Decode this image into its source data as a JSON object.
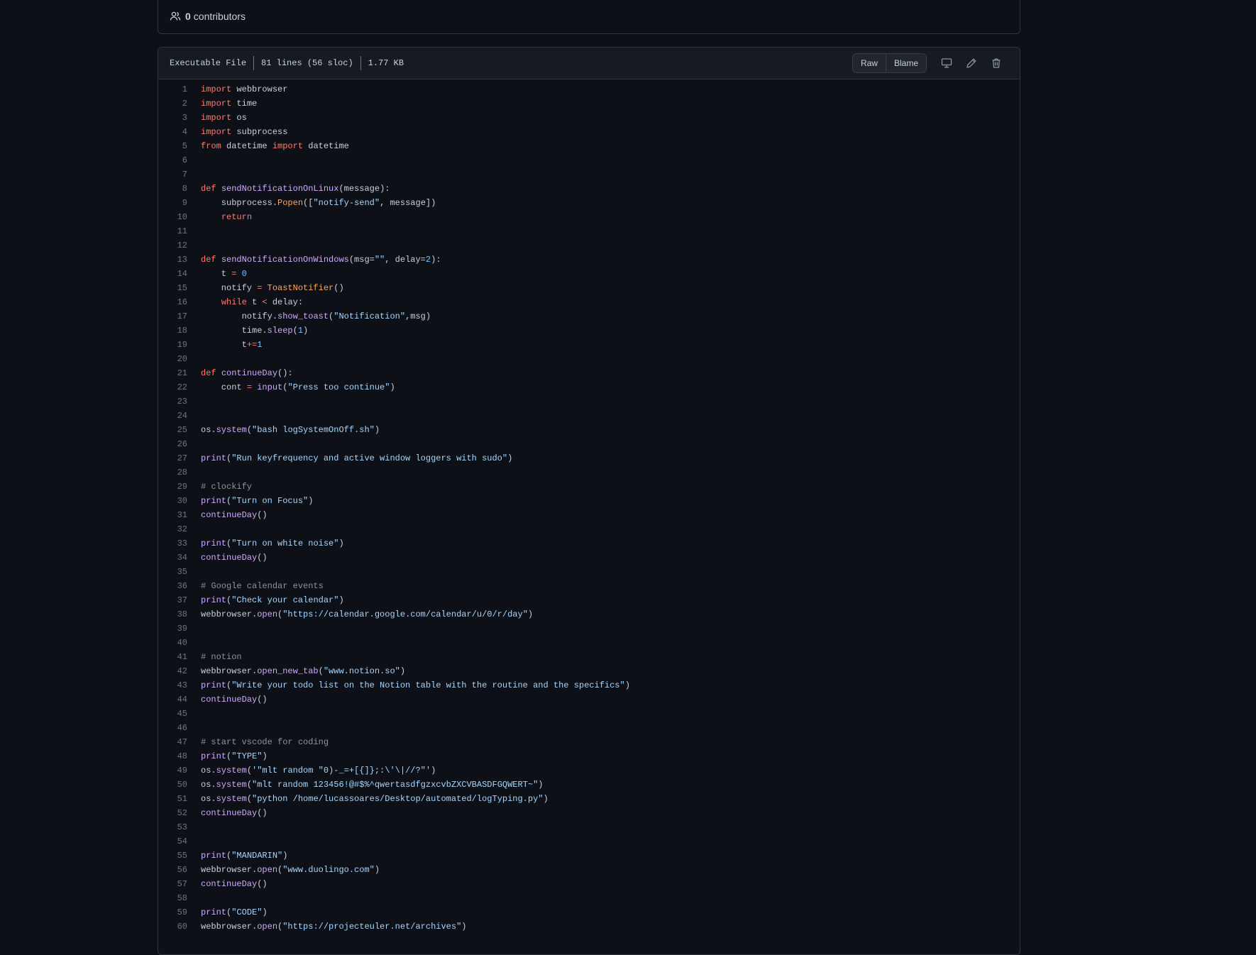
{
  "contributors": {
    "count": "0",
    "label": "contributors"
  },
  "file_header": {
    "type": "Executable File",
    "lines": "81 lines (56 sloc)",
    "size": "1.77 KB",
    "raw_label": "Raw",
    "blame_label": "Blame",
    "icons": [
      "desktop-icon",
      "pencil-icon",
      "trash-icon"
    ]
  },
  "colors": {
    "background": "#0d1117",
    "keyword": "#ff7b72",
    "function": "#d2a8ff",
    "string": "#a5d6ff",
    "class": "#ffa657",
    "number": "#79c0ff",
    "comment": "#8b949e"
  },
  "code_lines": [
    [
      [
        "kw",
        "import"
      ],
      [
        "t",
        " webbrowser"
      ]
    ],
    [
      [
        "kw",
        "import"
      ],
      [
        "t",
        " time"
      ]
    ],
    [
      [
        "kw",
        "import"
      ],
      [
        "t",
        " os"
      ]
    ],
    [
      [
        "kw",
        "import"
      ],
      [
        "t",
        " subprocess"
      ]
    ],
    [
      [
        "kw",
        "from"
      ],
      [
        "t",
        " datetime "
      ],
      [
        "kw",
        "import"
      ],
      [
        "t",
        " datetime"
      ]
    ],
    [],
    [],
    [
      [
        "kw",
        "def"
      ],
      [
        "t",
        " "
      ],
      [
        "fn",
        "sendNotificationOnLinux"
      ],
      [
        "t",
        "(message):"
      ]
    ],
    [
      [
        "t",
        "    subprocess."
      ],
      [
        "cls",
        "Popen"
      ],
      [
        "t",
        "(["
      ],
      [
        "str",
        "\"notify-send\""
      ],
      [
        "t",
        ", message])"
      ]
    ],
    [
      [
        "t",
        "    "
      ],
      [
        "kw",
        "return"
      ]
    ],
    [],
    [],
    [
      [
        "kw",
        "def"
      ],
      [
        "t",
        " "
      ],
      [
        "fn",
        "sendNotificationOnWindows"
      ],
      [
        "t",
        "(msg="
      ],
      [
        "str",
        "\"\""
      ],
      [
        "t",
        ", delay="
      ],
      [
        "num",
        "2"
      ],
      [
        "t",
        "):"
      ]
    ],
    [
      [
        "t",
        "    t "
      ],
      [
        "op",
        "="
      ],
      [
        "t",
        " "
      ],
      [
        "num",
        "0"
      ]
    ],
    [
      [
        "t",
        "    notify "
      ],
      [
        "op",
        "="
      ],
      [
        "t",
        " "
      ],
      [
        "cls",
        "ToastNotifier"
      ],
      [
        "t",
        "()"
      ]
    ],
    [
      [
        "t",
        "    "
      ],
      [
        "kw",
        "while"
      ],
      [
        "t",
        " t "
      ],
      [
        "op",
        "<"
      ],
      [
        "t",
        " delay:"
      ]
    ],
    [
      [
        "t",
        "        notify."
      ],
      [
        "fn",
        "show_toast"
      ],
      [
        "t",
        "("
      ],
      [
        "str",
        "\"Notification\""
      ],
      [
        "t",
        ",msg)"
      ]
    ],
    [
      [
        "t",
        "        time."
      ],
      [
        "fn",
        "sleep"
      ],
      [
        "t",
        "("
      ],
      [
        "num",
        "1"
      ],
      [
        "t",
        ")"
      ]
    ],
    [
      [
        "t",
        "        t"
      ],
      [
        "op",
        "+="
      ],
      [
        "num",
        "1"
      ]
    ],
    [],
    [
      [
        "kw",
        "def"
      ],
      [
        "t",
        " "
      ],
      [
        "fn",
        "continueDay"
      ],
      [
        "t",
        "():"
      ]
    ],
    [
      [
        "t",
        "    cont "
      ],
      [
        "op",
        "="
      ],
      [
        "t",
        " "
      ],
      [
        "fn",
        "input"
      ],
      [
        "t",
        "("
      ],
      [
        "str",
        "\"Press too continue\""
      ],
      [
        "t",
        ")"
      ]
    ],
    [],
    [],
    [
      [
        "t",
        "os."
      ],
      [
        "fn",
        "system"
      ],
      [
        "t",
        "("
      ],
      [
        "str",
        "\"bash logSystemOnOff.sh\""
      ],
      [
        "t",
        ")"
      ]
    ],
    [],
    [
      [
        "fn",
        "print"
      ],
      [
        "t",
        "("
      ],
      [
        "str",
        "\"Run keyfrequency and active window loggers with sudo\""
      ],
      [
        "t",
        ")"
      ]
    ],
    [],
    [
      [
        "cm",
        "# clockify"
      ]
    ],
    [
      [
        "fn",
        "print"
      ],
      [
        "t",
        "("
      ],
      [
        "str",
        "\"Turn on Focus\""
      ],
      [
        "t",
        ")"
      ]
    ],
    [
      [
        "fn",
        "continueDay"
      ],
      [
        "t",
        "()"
      ]
    ],
    [],
    [
      [
        "fn",
        "print"
      ],
      [
        "t",
        "("
      ],
      [
        "str",
        "\"Turn on white noise\""
      ],
      [
        "t",
        ")"
      ]
    ],
    [
      [
        "fn",
        "continueDay"
      ],
      [
        "t",
        "()"
      ]
    ],
    [],
    [
      [
        "cm",
        "# Google calendar events"
      ]
    ],
    [
      [
        "fn",
        "print"
      ],
      [
        "t",
        "("
      ],
      [
        "str",
        "\"Check your calendar\""
      ],
      [
        "t",
        ")"
      ]
    ],
    [
      [
        "t",
        "webbrowser."
      ],
      [
        "fn",
        "open"
      ],
      [
        "t",
        "("
      ],
      [
        "str",
        "\"https://calendar.google.com/calendar/u/0/r/day\""
      ],
      [
        "t",
        ")"
      ]
    ],
    [],
    [],
    [
      [
        "cm",
        "# notion"
      ]
    ],
    [
      [
        "t",
        "webbrowser."
      ],
      [
        "fn",
        "open_new_tab"
      ],
      [
        "t",
        "("
      ],
      [
        "str",
        "\"www.notion.so\""
      ],
      [
        "t",
        ")"
      ]
    ],
    [
      [
        "fn",
        "print"
      ],
      [
        "t",
        "("
      ],
      [
        "str",
        "\"Write your todo list on the Notion table with the routine and the specifics\""
      ],
      [
        "t",
        ")"
      ]
    ],
    [
      [
        "fn",
        "continueDay"
      ],
      [
        "t",
        "()"
      ]
    ],
    [],
    [],
    [
      [
        "cm",
        "# start vscode for coding"
      ]
    ],
    [
      [
        "fn",
        "print"
      ],
      [
        "t",
        "("
      ],
      [
        "str",
        "\"TYPE\""
      ],
      [
        "t",
        ")"
      ]
    ],
    [
      [
        "t",
        "os."
      ],
      [
        "fn",
        "system"
      ],
      [
        "t",
        "("
      ],
      [
        "str",
        "'\"mlt random \"0)-_=+[{]};:\\'\\|//?\"'"
      ],
      [
        "t",
        ")"
      ]
    ],
    [
      [
        "t",
        "os."
      ],
      [
        "fn",
        "system"
      ],
      [
        "t",
        "("
      ],
      [
        "str",
        "\"mlt random 123456!@#$%^qwertasdfgzxcvbZXCVBASDFGQWERT~\""
      ],
      [
        "t",
        ")"
      ]
    ],
    [
      [
        "t",
        "os."
      ],
      [
        "fn",
        "system"
      ],
      [
        "t",
        "("
      ],
      [
        "str",
        "\"python /home/lucassoares/Desktop/automated/logTyping.py\""
      ],
      [
        "t",
        ")"
      ]
    ],
    [
      [
        "fn",
        "continueDay"
      ],
      [
        "t",
        "()"
      ]
    ],
    [],
    [],
    [
      [
        "fn",
        "print"
      ],
      [
        "t",
        "("
      ],
      [
        "str",
        "\"MANDARIN\""
      ],
      [
        "t",
        ")"
      ]
    ],
    [
      [
        "t",
        "webbrowser."
      ],
      [
        "fn",
        "open"
      ],
      [
        "t",
        "("
      ],
      [
        "str",
        "\"www.duolingo.com\""
      ],
      [
        "t",
        ")"
      ]
    ],
    [
      [
        "fn",
        "continueDay"
      ],
      [
        "t",
        "()"
      ]
    ],
    [],
    [
      [
        "fn",
        "print"
      ],
      [
        "t",
        "("
      ],
      [
        "str",
        "\"CODE\""
      ],
      [
        "t",
        ")"
      ]
    ],
    [
      [
        "t",
        "webbrowser."
      ],
      [
        "fn",
        "open"
      ],
      [
        "t",
        "("
      ],
      [
        "str",
        "\"https://projecteuler.net/archives\""
      ],
      [
        "t",
        ")"
      ]
    ]
  ]
}
